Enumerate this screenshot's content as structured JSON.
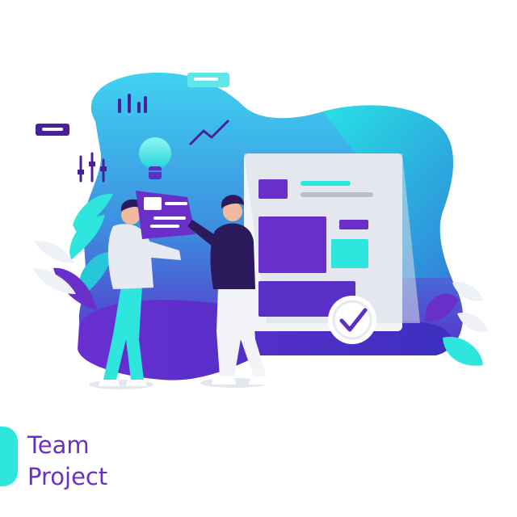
{
  "title": {
    "line1": "Team",
    "line2": "Project"
  },
  "icons": [
    "bar-chart-icon",
    "trend-line-icon",
    "lightbulb-icon",
    "sliders-icon",
    "checkmark-icon",
    "label-tag-icon"
  ],
  "colors": {
    "accent": "#2ee6de",
    "purple": "#6b2fc9",
    "deep_purple": "#4a1f9e",
    "navy": "#2b1a5c",
    "light_gray": "#e9edf3"
  }
}
